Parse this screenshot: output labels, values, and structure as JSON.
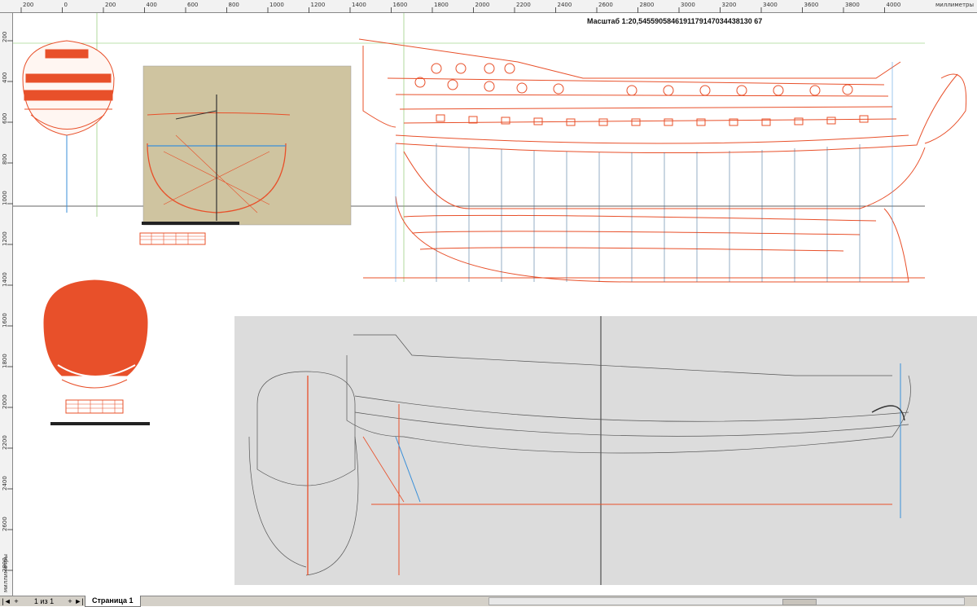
{
  "rulers": {
    "unit": "миллиметры",
    "h_ticks": [
      "200",
      "0",
      "200",
      "400",
      "600",
      "800",
      "1000",
      "1200",
      "1400",
      "1600",
      "1800",
      "2000",
      "2200",
      "2400",
      "2600",
      "2800",
      "3000",
      "3200",
      "3400",
      "3600",
      "3800",
      "4000"
    ],
    "v_ticks": [
      "200",
      "400",
      "600",
      "800",
      "1000",
      "1200",
      "1400",
      "1600",
      "1800",
      "2000",
      "2200",
      "2400",
      "2600",
      "2800"
    ],
    "v_unit": "миллиметры"
  },
  "canvas": {
    "scale_label": "Масштаб 1:20,5455905846191179147034438130 67"
  },
  "status": {
    "first_page": "|◄",
    "add_before": "+",
    "page_counter": "1 из 1",
    "add_after": "+",
    "last_page": "►|",
    "page_tab": "Страница 1"
  },
  "colors": {
    "orange": "#e8502a",
    "blue": "#3a8fd8",
    "green": "#7ec25a",
    "dark": "#333333",
    "paper_photo": "#cfc4a0",
    "paper_grey": "#dcdcdc"
  }
}
